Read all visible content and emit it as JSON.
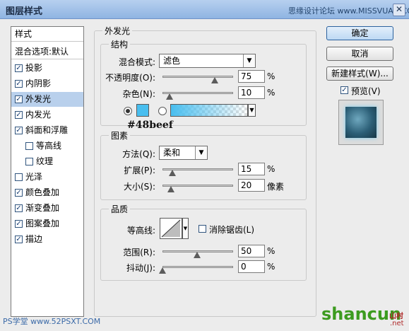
{
  "window": {
    "title": "图层样式",
    "watermark": "思缘设计论坛 www.MISSVUAN.COM",
    "close_glyph": "✕"
  },
  "sidebar": {
    "header_label": "样式",
    "blend_label": "混合选项:默认",
    "items": [
      {
        "label": "投影",
        "checked": true
      },
      {
        "label": "内阴影",
        "checked": true
      },
      {
        "label": "外发光",
        "checked": true,
        "selected": true
      },
      {
        "label": "内发光",
        "checked": true
      },
      {
        "label": "斜面和浮雕",
        "checked": true
      },
      {
        "label": "等高线",
        "checked": false,
        "indent": true
      },
      {
        "label": "纹理",
        "checked": false,
        "indent": true
      },
      {
        "label": "光泽",
        "checked": false
      },
      {
        "label": "颜色叠加",
        "checked": true
      },
      {
        "label": "渐变叠加",
        "checked": true
      },
      {
        "label": "图案叠加",
        "checked": true
      },
      {
        "label": "描边",
        "checked": true
      }
    ],
    "check_glyph": "✓"
  },
  "panel": {
    "title": "外发光",
    "structure": {
      "legend": "结构",
      "blend_mode_label": "混合模式:",
      "blend_mode_value": "滤色",
      "opacity_label": "不透明度(O):",
      "opacity_value": "75",
      "opacity_unit": "%",
      "noise_label": "杂色(N):",
      "noise_value": "10",
      "noise_unit": "%",
      "glow_color": "#48beef",
      "color_text": "#48beef"
    },
    "elements": {
      "legend": "图素",
      "method_label": "方法(Q):",
      "method_value": "柔和",
      "spread_label": "扩展(P):",
      "spread_value": "15",
      "spread_unit": "%",
      "size_label": "大小(S):",
      "size_value": "20",
      "size_unit": "像素"
    },
    "quality": {
      "legend": "品质",
      "contour_label": "等高线:",
      "antialias_label": "消除锯齿(L)",
      "antialias_checked": false,
      "range_label": "范围(R):",
      "range_value": "50",
      "range_unit": "%",
      "jitter_label": "抖动(J):",
      "jitter_value": "0",
      "jitter_unit": "%"
    },
    "dropdown_glyph": "▼"
  },
  "buttons": {
    "ok": "确定",
    "cancel": "取消",
    "new_style": "新建样式(W)...",
    "preview_label": "预览(V)",
    "preview_checked": true
  },
  "bottom_watermarks": {
    "left": "PS学堂 www.52PSXT.COM",
    "right": "shancun",
    "right_sub": "山村",
    "right_domain": ".net"
  }
}
